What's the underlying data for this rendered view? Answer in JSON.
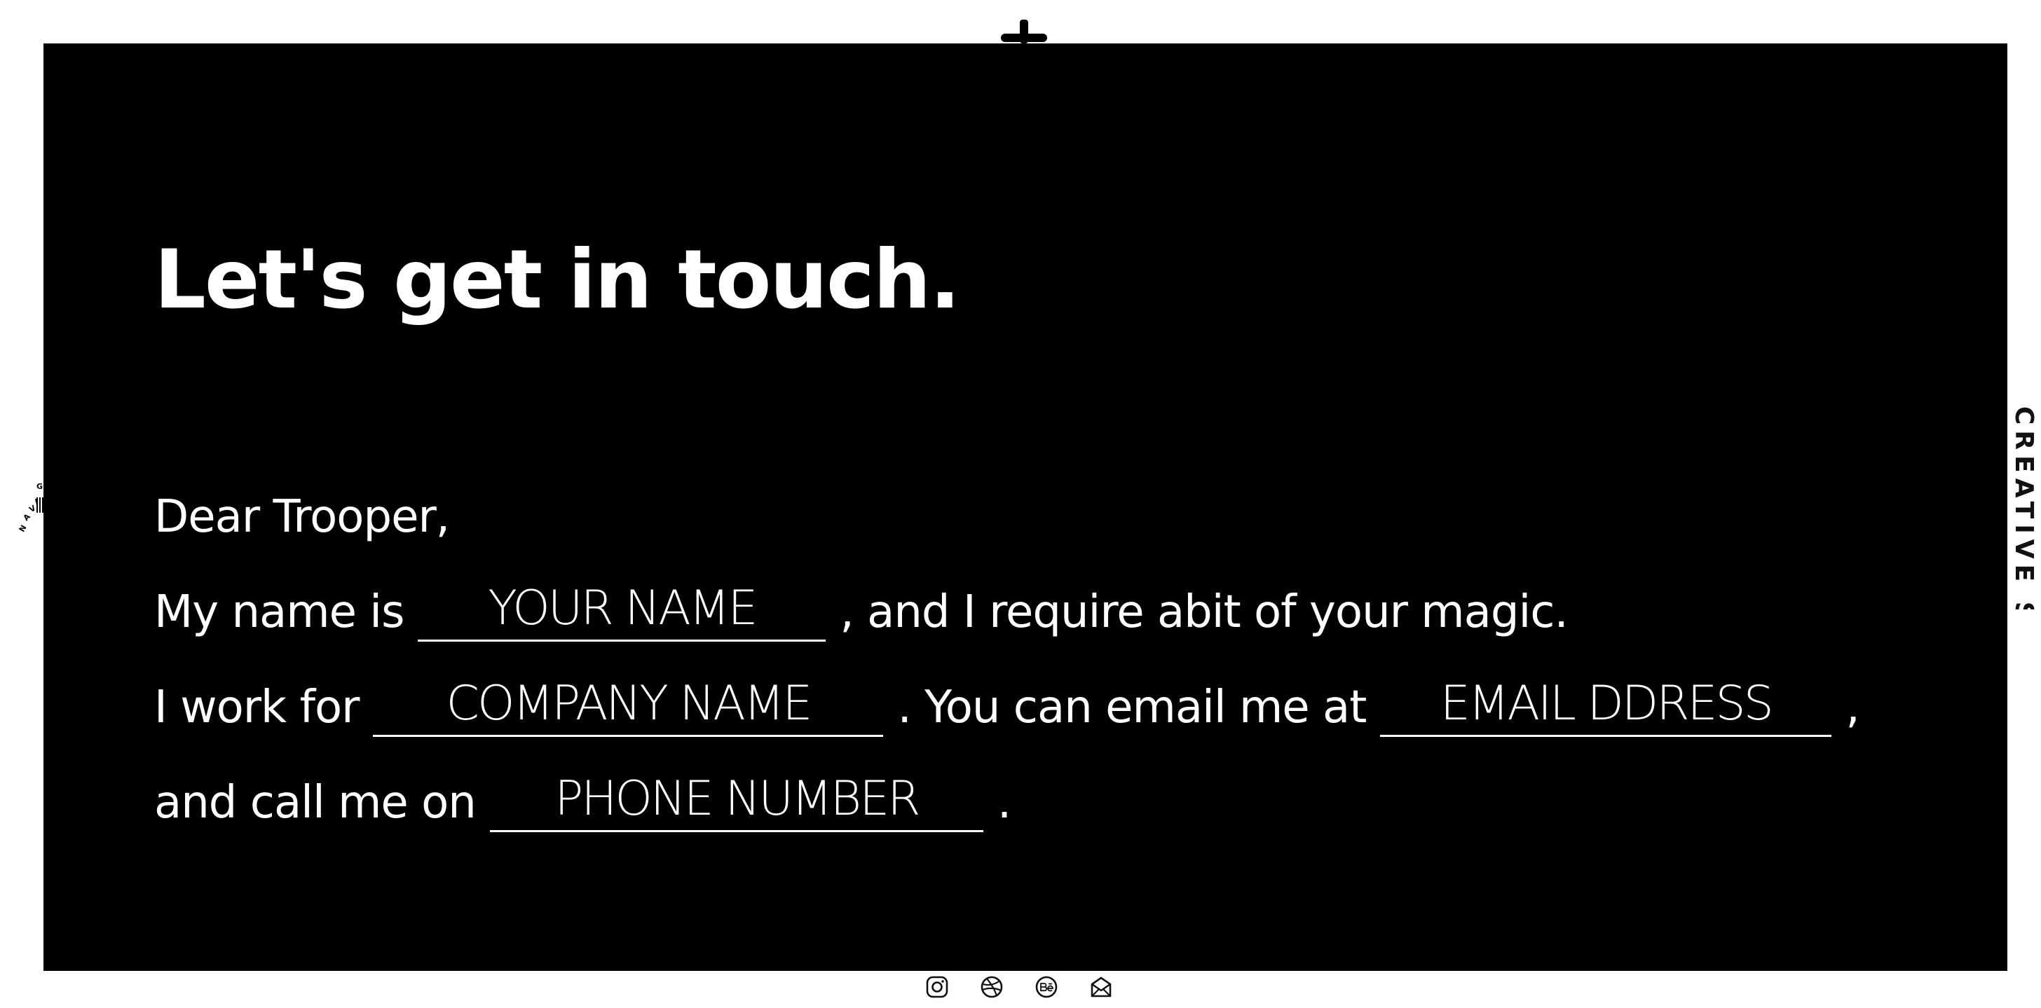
{
  "header": {
    "close_icon": "plus-icon"
  },
  "contact": {
    "title": "Let's get in touch.",
    "greeting": "Dear Trooper,",
    "line1_prefix": "My name is",
    "line1_suffix": ", and I require abit of your magic.",
    "line2_prefix": "I work for",
    "line2_middle": ". You can email me at",
    "line2_suffix": ",",
    "line3_prefix": "and call me on",
    "line3_suffix": ".",
    "fields": {
      "name_placeholder": "YOUR NAME",
      "company_placeholder": "COMPANY NAME",
      "email_placeholder": "EMAIL DDRESS",
      "phone_placeholder": "PHONE NUMBER"
    }
  },
  "side_nav": {
    "letters": [
      "N",
      "A",
      "V",
      "I",
      "G"
    ]
  },
  "side_label": {
    "text": "CREATIVE STUDIO"
  },
  "socials": [
    {
      "name": "instagram-icon"
    },
    {
      "name": "dribbble-icon"
    },
    {
      "name": "behance-icon"
    },
    {
      "name": "mail-icon"
    }
  ],
  "colors": {
    "panel": "#000000",
    "text": "#ffffff",
    "page": "#ffffff"
  }
}
